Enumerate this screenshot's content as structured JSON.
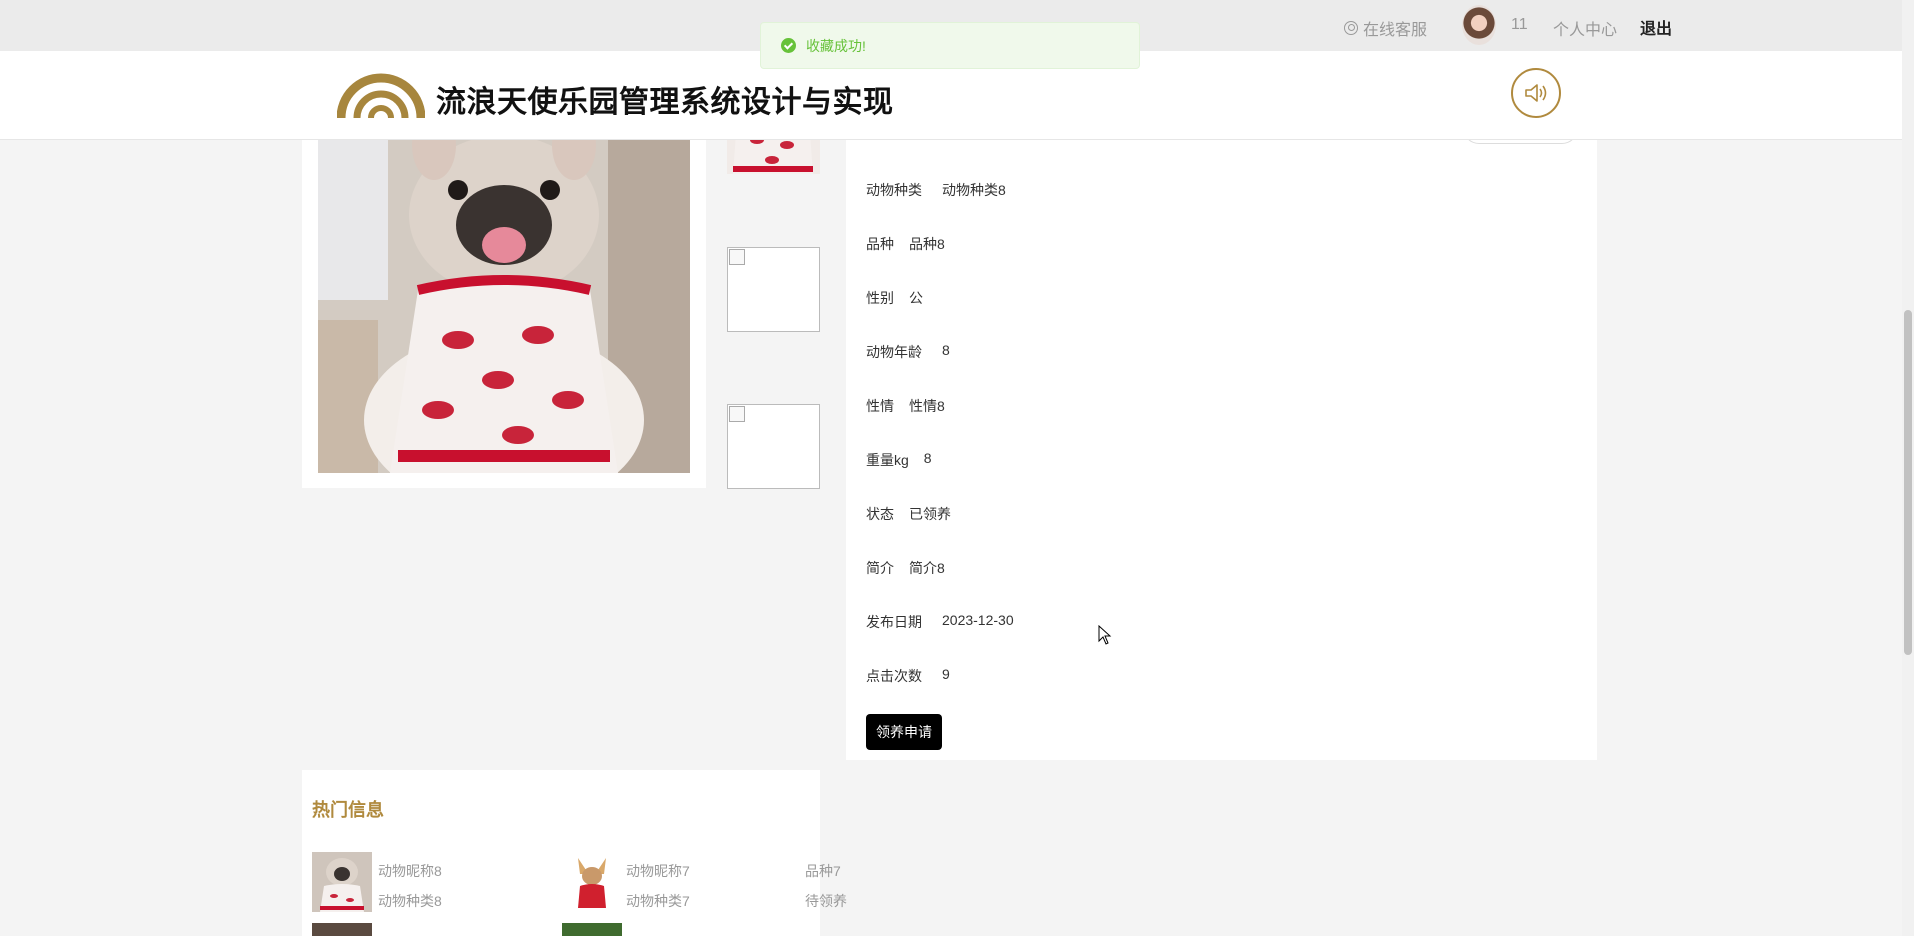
{
  "topbar": {
    "service_label": "在线客服",
    "username": "11",
    "center_label": "个人中心",
    "logout_label": "退出"
  },
  "header": {
    "title": "流浪天使乐园管理系统设计与实现",
    "sound_icon": "speaker-icon"
  },
  "toast": {
    "message": "收藏成功!",
    "color": "#67c23a"
  },
  "detail": {
    "fields": [
      {
        "label": "动物种类",
        "value": "动物种类8"
      },
      {
        "label": "品种",
        "value": "品种8"
      },
      {
        "label": "性别",
        "value": "公"
      },
      {
        "label": "动物年龄",
        "value": "8"
      },
      {
        "label": "性情",
        "value": "性情8"
      },
      {
        "label": "重量kg",
        "value": "8"
      },
      {
        "label": "状态",
        "value": "已领养"
      },
      {
        "label": "简介",
        "value": "简介8"
      },
      {
        "label": "发布日期",
        "value": "2023-12-30"
      },
      {
        "label": "点击次数",
        "value": "9"
      }
    ],
    "adopt_button": "领养申请"
  },
  "hot": {
    "title": "热门信息",
    "items": [
      {
        "name": "动物昵称8",
        "category": "动物种类8"
      },
      {
        "name": "动物昵称7",
        "category": "动物种类7",
        "breed": "品种7",
        "status": "待领养"
      }
    ]
  },
  "colors": {
    "accent": "#b08a3e",
    "button": "#000000"
  }
}
